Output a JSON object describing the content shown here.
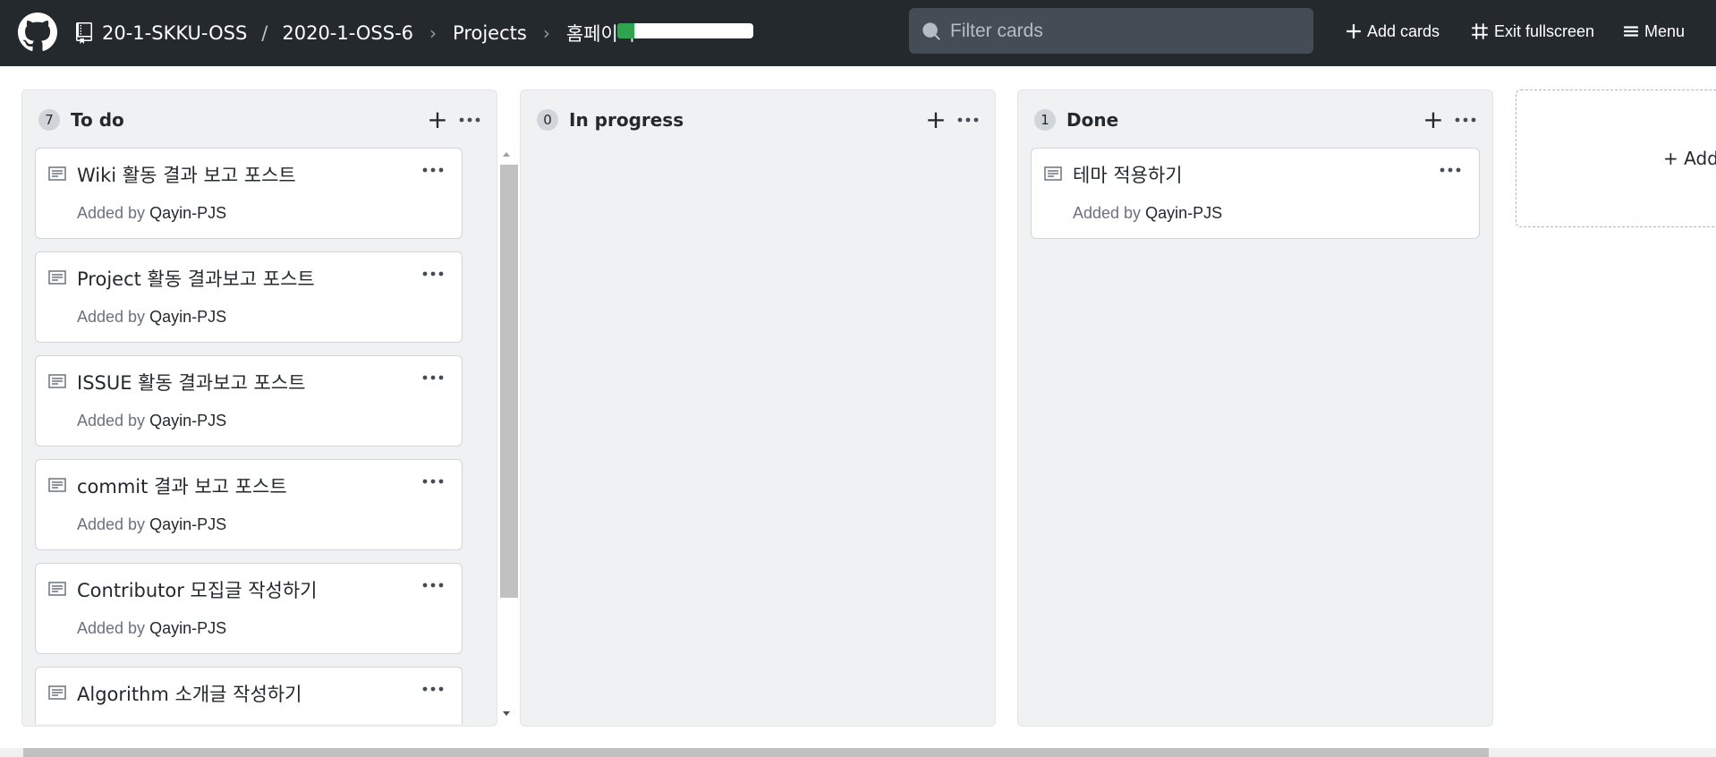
{
  "header": {
    "org": "20-1-SKKU-OSS",
    "repo": "2020-1-OSS-6",
    "separator": "/",
    "section": "Projects",
    "project": "홈페이지",
    "progress_done_fraction": 0.125,
    "filter_placeholder": "Filter cards",
    "add_cards_label": "Add cards",
    "exit_fullscreen_label": "Exit fullscreen",
    "menu_label": "Menu"
  },
  "columns": [
    {
      "count": "7",
      "title": "To do",
      "cards": [
        {
          "title": "Wiki 활동 결과 보고 포스트",
          "added_by_label": "Added by",
          "author": "Qayin-PJS"
        },
        {
          "title": "Project 활동 결과보고 포스트",
          "added_by_label": "Added by",
          "author": "Qayin-PJS"
        },
        {
          "title": "ISSUE 활동 결과보고 포스트",
          "added_by_label": "Added by",
          "author": "Qayin-PJS"
        },
        {
          "title": "commit 결과 보고 포스트",
          "added_by_label": "Added by",
          "author": "Qayin-PJS"
        },
        {
          "title": "Contributor 모집글 작성하기",
          "added_by_label": "Added by",
          "author": "Qayin-PJS"
        },
        {
          "title": "Algorithm 소개글 작성하기"
        }
      ]
    },
    {
      "count": "0",
      "title": "In progress",
      "cards": []
    },
    {
      "count": "1",
      "title": "Done",
      "cards": [
        {
          "title": "테마 적용하기",
          "added_by_label": "Added by",
          "author": "Qayin-PJS"
        }
      ]
    }
  ],
  "add_column_label": "+ Add",
  "colors": {
    "header_bg": "#24292e",
    "progress_green": "#2ea44f",
    "column_bg": "#eff1f3"
  }
}
